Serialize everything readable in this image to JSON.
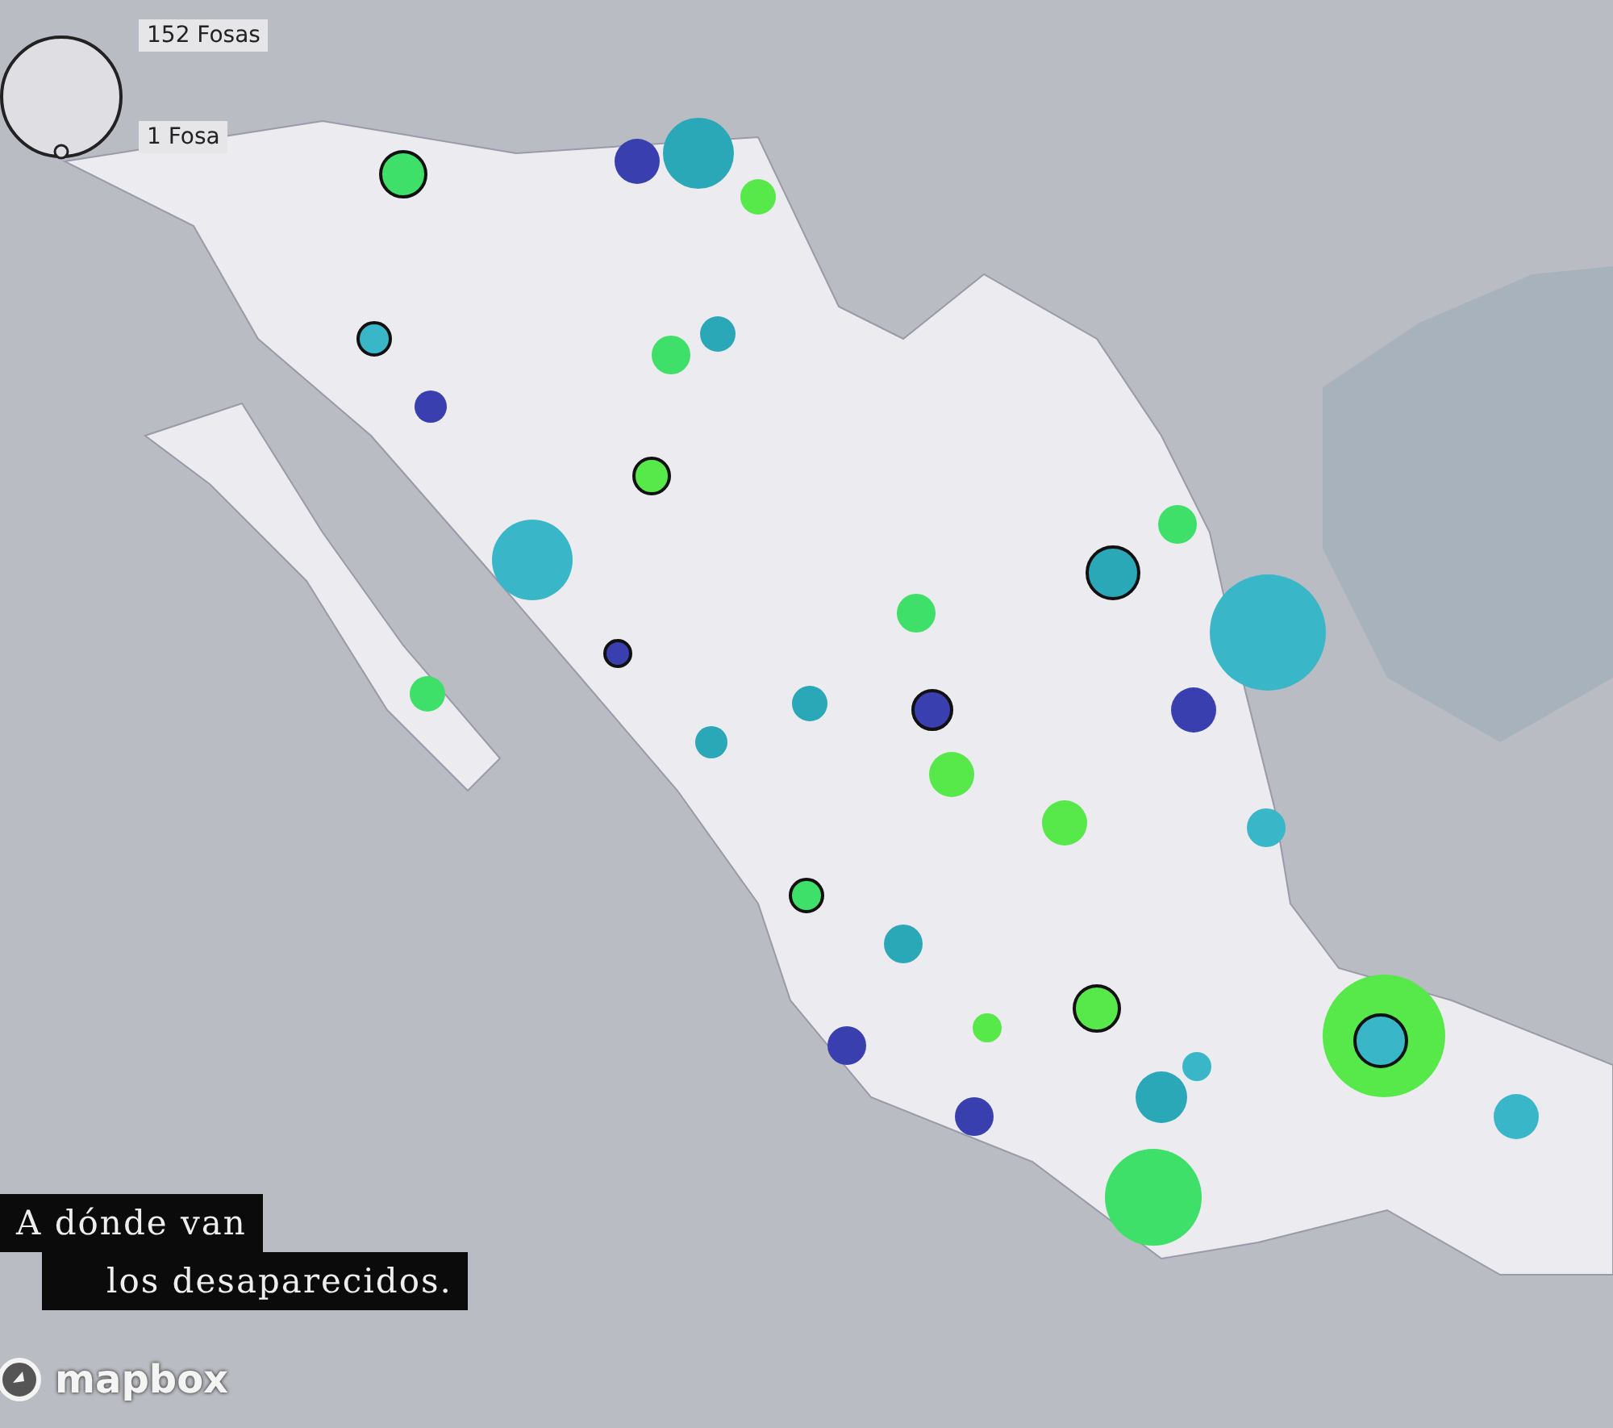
{
  "legend": {
    "max_label": "152 Fosas",
    "min_label": "1 Fosa"
  },
  "title": {
    "lines": [
      "A dónde van",
      "los desaparecidos."
    ]
  },
  "attribution": {
    "logo_text": "mapbox"
  }
}
